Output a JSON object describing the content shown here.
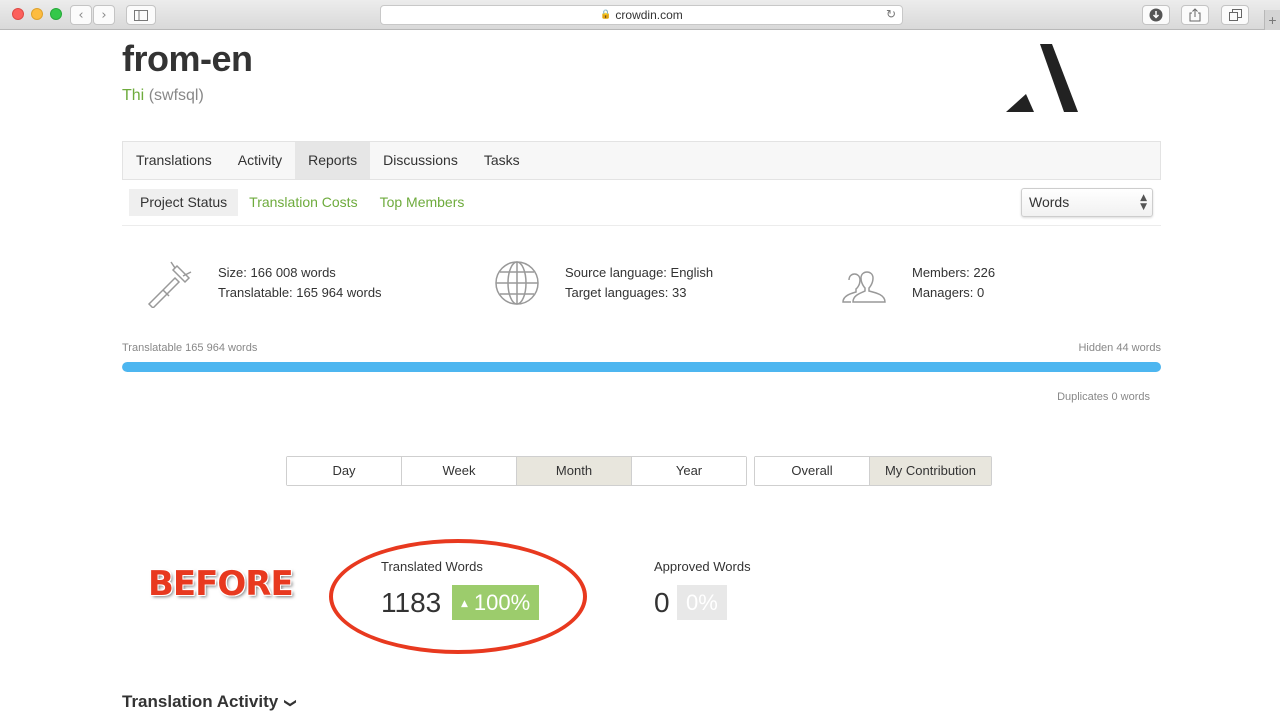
{
  "browser": {
    "url": "crowdin.com"
  },
  "project": {
    "title": "from-en",
    "owner_name": "Thi",
    "owner_handle": "(swfsql)"
  },
  "tabs": [
    {
      "label": "Translations"
    },
    {
      "label": "Activity"
    },
    {
      "label": "Reports",
      "active": true
    },
    {
      "label": "Discussions"
    },
    {
      "label": "Tasks"
    }
  ],
  "subnav": [
    {
      "label": "Project Status",
      "active": true
    },
    {
      "label": "Translation Costs"
    },
    {
      "label": "Top Members"
    }
  ],
  "unit_select": {
    "value": "Words"
  },
  "stats": {
    "size": "Size: 166 008 words",
    "translatable": "Translatable: 165 964 words",
    "source_language": "Source language: English",
    "target_languages": "Target languages: 33",
    "members": "Members: 226",
    "managers": "Managers: 0"
  },
  "progress": {
    "left_label": "Translatable 165 964 words",
    "right_label": "Hidden 44 words",
    "fill_fraction": 0.9997,
    "duplicates_label": "Duplicates 0 words",
    "color": "#4db6f0"
  },
  "period_buttons": [
    {
      "label": "Day"
    },
    {
      "label": "Week"
    },
    {
      "label": "Month",
      "active": true
    },
    {
      "label": "Year"
    }
  ],
  "scope_buttons": [
    {
      "label": "Overall"
    },
    {
      "label": "My Contribution",
      "active": true
    }
  ],
  "annotation": {
    "text": "BEFORE",
    "color": "#e8391f"
  },
  "metrics": {
    "translated": {
      "label": "Translated Words",
      "value": "1183",
      "change": "100%"
    },
    "approved": {
      "label": "Approved Words",
      "value": "0",
      "change": "0%"
    }
  },
  "section": {
    "title": "Translation Activity"
  },
  "colors": {
    "accent_green": "#6eab3d",
    "progress_blue": "#4db6f0",
    "positive_badge": "#9ccc6c"
  }
}
